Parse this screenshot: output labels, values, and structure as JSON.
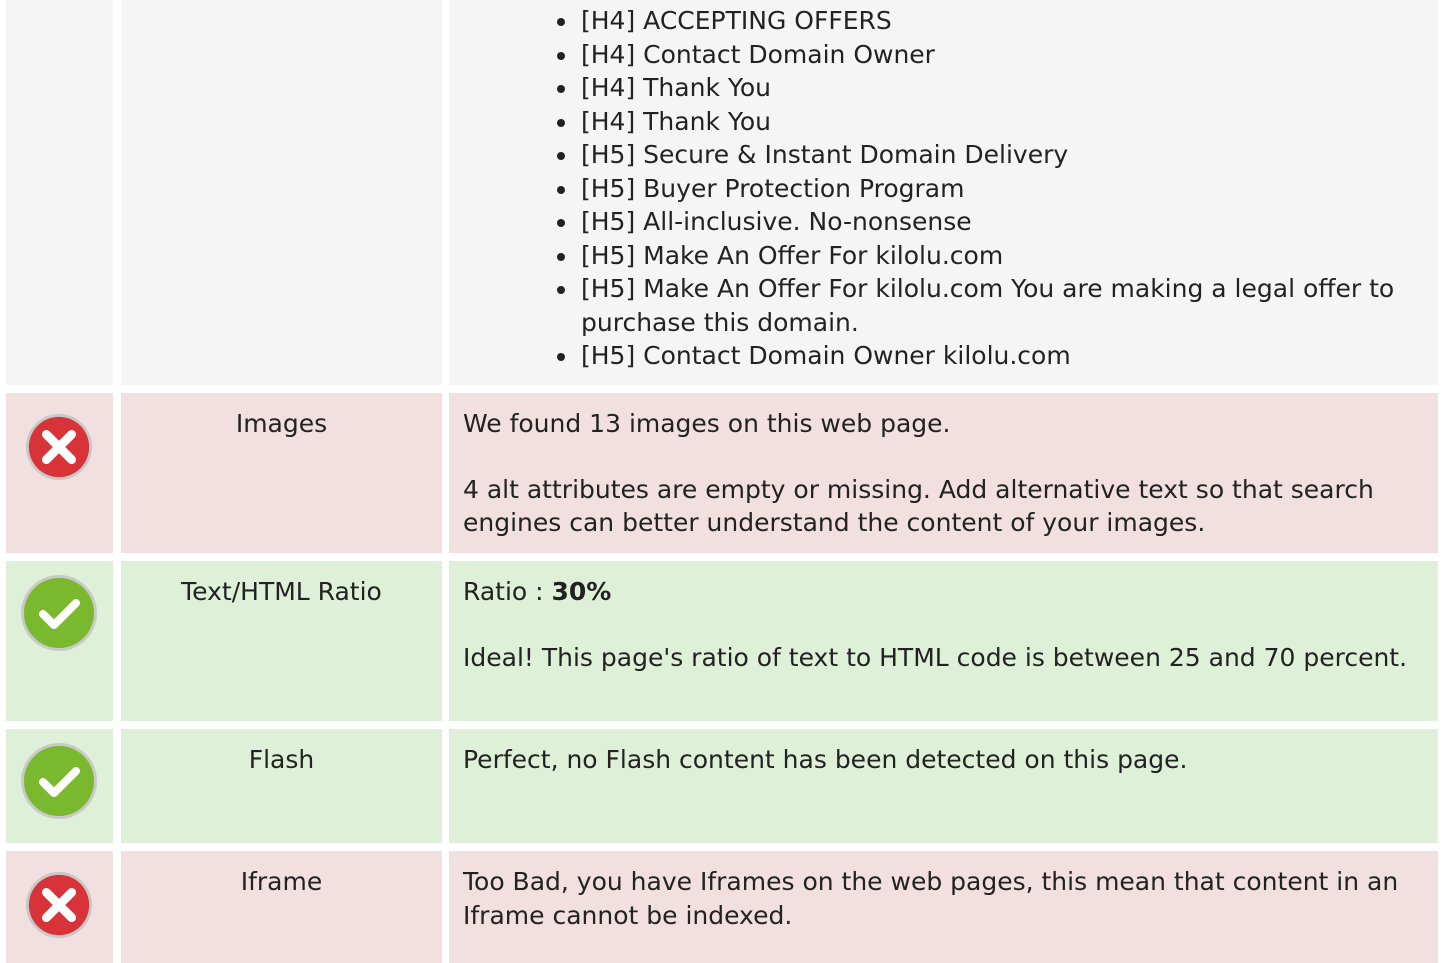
{
  "headings_row": {
    "items": [
      "[H4] ACCEPTING OFFERS",
      "[H4] Contact Domain Owner",
      "[H4] Thank You",
      "[H4] Thank You",
      "[H5] Secure & Instant Domain Delivery",
      "[H5] Buyer Protection Program",
      "[H5] All-inclusive. No-nonsense",
      "[H5] Make An Offer For kilolu.com",
      "[H5] Make An Offer For kilolu.com You are making a legal offer to purchase this domain.",
      "[H5] Contact Domain Owner kilolu.com"
    ]
  },
  "images": {
    "status": "error-icon",
    "label": "Images",
    "line1": "We found 13 images on this web page.",
    "line2": "4 alt attributes are empty or missing. Add alternative text so that search engines can better understand the content of your images."
  },
  "ratio": {
    "status": "check-icon",
    "label": "Text/HTML Ratio",
    "prefix": "Ratio : ",
    "value": "30%",
    "line2": "Ideal! This page's ratio of text to HTML code is between 25 and 70 percent."
  },
  "flash": {
    "status": "check-icon",
    "label": "Flash",
    "line1": "Perfect, no Flash content has been detected on this page."
  },
  "iframe": {
    "status": "error-icon",
    "label": "Iframe",
    "line1": "Too Bad, you have Iframes on the web pages, this mean that content in an Iframe cannot be indexed."
  },
  "colors": {
    "neutral_bg": "#f5f5f5",
    "bad_bg": "#f2dfe0",
    "good_bg": "#dff0d8",
    "error_red": "#d9333a",
    "check_green": "#7ab82e"
  }
}
